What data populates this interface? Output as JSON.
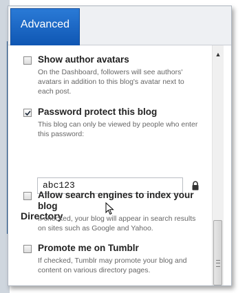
{
  "tabs": {
    "advanced_label": "Advanced"
  },
  "options": {
    "avatars": {
      "label": "Show author avatars",
      "description": "On the Dashboard, followers will see authors' avatars in addition to this blog's avatar next to each post.",
      "checked": false
    },
    "password": {
      "label": "Password protect this blog",
      "description": "This blog can only be viewed by people who enter this password:",
      "checked": true,
      "value": "abc123"
    },
    "search_engines": {
      "label": "Allow search engines to index your blog",
      "description": "If checked, your blog will appear in search results on sites such as Google and Yahoo.",
      "checked": false
    },
    "tumblr": {
      "label": "Promote me on Tumblr",
      "description": "If checked, Tumblr may promote your blog and content on various directory pages.",
      "checked": false
    }
  },
  "sections": {
    "directory_heading": "Directory"
  },
  "icons": {
    "lock": "lock-icon",
    "scroll_up": "chevron-up-icon",
    "cursor": "mouse-pointer-icon"
  },
  "colors": {
    "tab_blue": "#1565c0",
    "text_dark": "#222222",
    "text_muted": "#666666",
    "background_blue": "#2a5d93"
  }
}
